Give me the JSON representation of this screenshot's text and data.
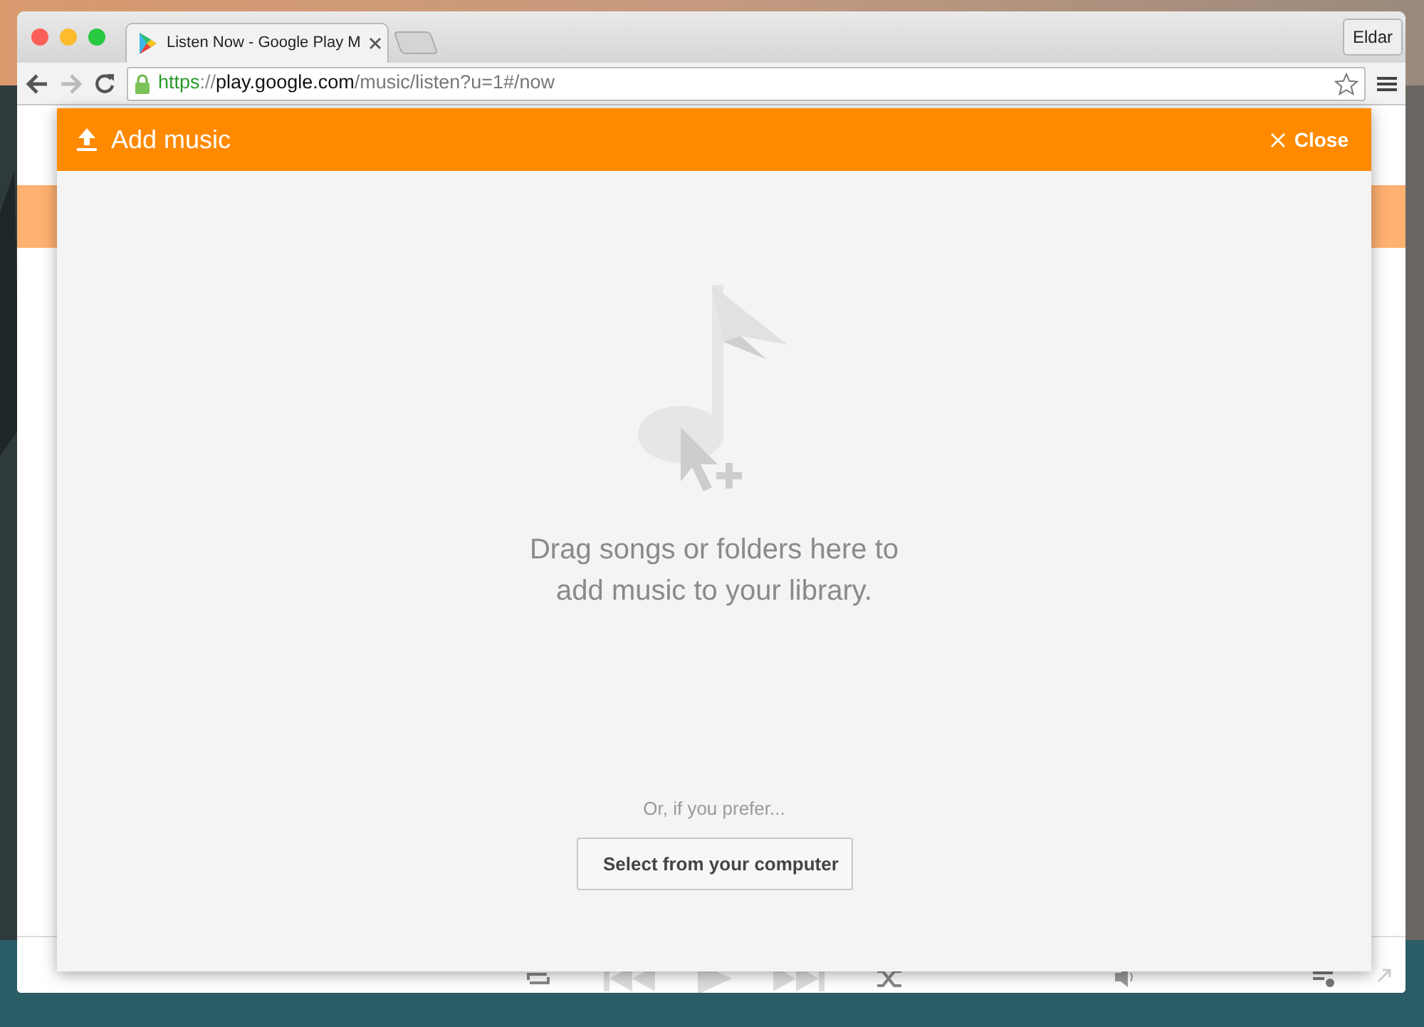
{
  "browser": {
    "tab": {
      "title": "Listen Now - Google Play M",
      "selected": true
    },
    "profile": "Eldar",
    "url": [
      {
        "kind": "scheme",
        "text": "https"
      },
      {
        "kind": "sep",
        "text": "://"
      },
      {
        "kind": "host",
        "text": "play.google.com"
      },
      {
        "kind": "path",
        "text": "/music/listen?u=1#/now"
      }
    ]
  },
  "dialog": {
    "title": "Add music",
    "close": "Close",
    "message": [
      "Drag songs or folders here to",
      "add music to your library."
    ],
    "alternative": "Or, if you prefer...",
    "button": "Select from your computer"
  }
}
